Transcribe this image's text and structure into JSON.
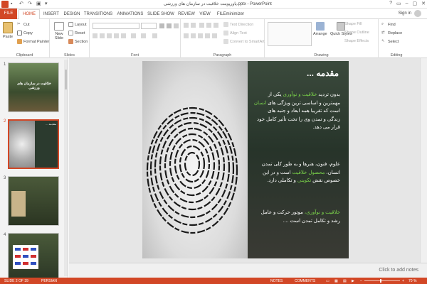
{
  "window": {
    "title": "پاورپوینت خلاقیت در سازمان های ورزشی.pptx - PowerPoint",
    "controls": [
      "?",
      "▭",
      "–",
      "▢",
      "✕"
    ]
  },
  "tabs": [
    "FILE",
    "HOME",
    "INSERT",
    "DESIGN",
    "TRANSITIONS",
    "ANIMATIONS",
    "SLIDE SHOW",
    "REVIEW",
    "VIEW",
    "FILEminimizer"
  ],
  "account": {
    "signin": "Sign in"
  },
  "ribbon": {
    "clipboard": {
      "label": "Clipboard",
      "paste": "Paste",
      "cut": "Cut",
      "copy": "Copy",
      "format_painter": "Format Painter"
    },
    "slides": {
      "label": "Slides",
      "new_slide": "New Slide",
      "layout": "Layout",
      "reset": "Reset",
      "section": "Section"
    },
    "font": {
      "label": "Font"
    },
    "paragraph": {
      "label": "Paragraph",
      "text_direction": "Text Direction",
      "align_text": "Align Text",
      "convert": "Convert to SmartArt"
    },
    "drawing": {
      "label": "Drawing",
      "arrange": "Arrange",
      "quick_styles": "Quick Styles",
      "shape_fill": "Shape Fill",
      "shape_outline": "Shape Outline",
      "shape_effects": "Shape Effects"
    },
    "editing": {
      "label": "Editing",
      "find": "Find",
      "replace": "Replace",
      "select": "Select"
    }
  },
  "thumbnails": [
    {
      "num": "1",
      "title": "خلاقیت در سازمان های ورزشی"
    },
    {
      "num": "2",
      "title": "مقدمه ..."
    },
    {
      "num": "3",
      "title": ""
    },
    {
      "num": "4",
      "title": ""
    }
  ],
  "slide": {
    "title": "مقدمه ...",
    "p1_pre": "بدون تردید ",
    "p1_hl1": "خلاقیت و نوآوری",
    "p1_mid": " یکی از مهمترین و اساسی ترین ویژگی های ",
    "p1_hl2": "انسان",
    "p1_post": " است که تقریبا همه ابعاد و جنبه های زندگی و تمدن وی را تحت تأثیر کامل خود قرار می دهد.",
    "p2_pre": "علوم، فنون، هنرها و به طور کلی تمدن انسان، ",
    "p2_hl1": "محصول خلاقیت",
    "p2_mid": " است و در این خصوص نقش ",
    "p2_hl2": "تکوینی",
    "p2_post": " و تکاملی دارد.",
    "p3_hl": "خلاقیت و نوآوری،",
    "p3_post": " موتور حرکت و عامل رشد و تکامل تمدن است ...."
  },
  "notes": {
    "placeholder": "Click to add notes"
  },
  "status": {
    "slide": "SLIDE 2 OF 39",
    "language": "PERSIAN",
    "notes": "NOTES",
    "comments": "COMMENTS",
    "zoom": "70 %"
  },
  "colors": {
    "accent": "#d24726",
    "highlight": "#7bd44a"
  }
}
